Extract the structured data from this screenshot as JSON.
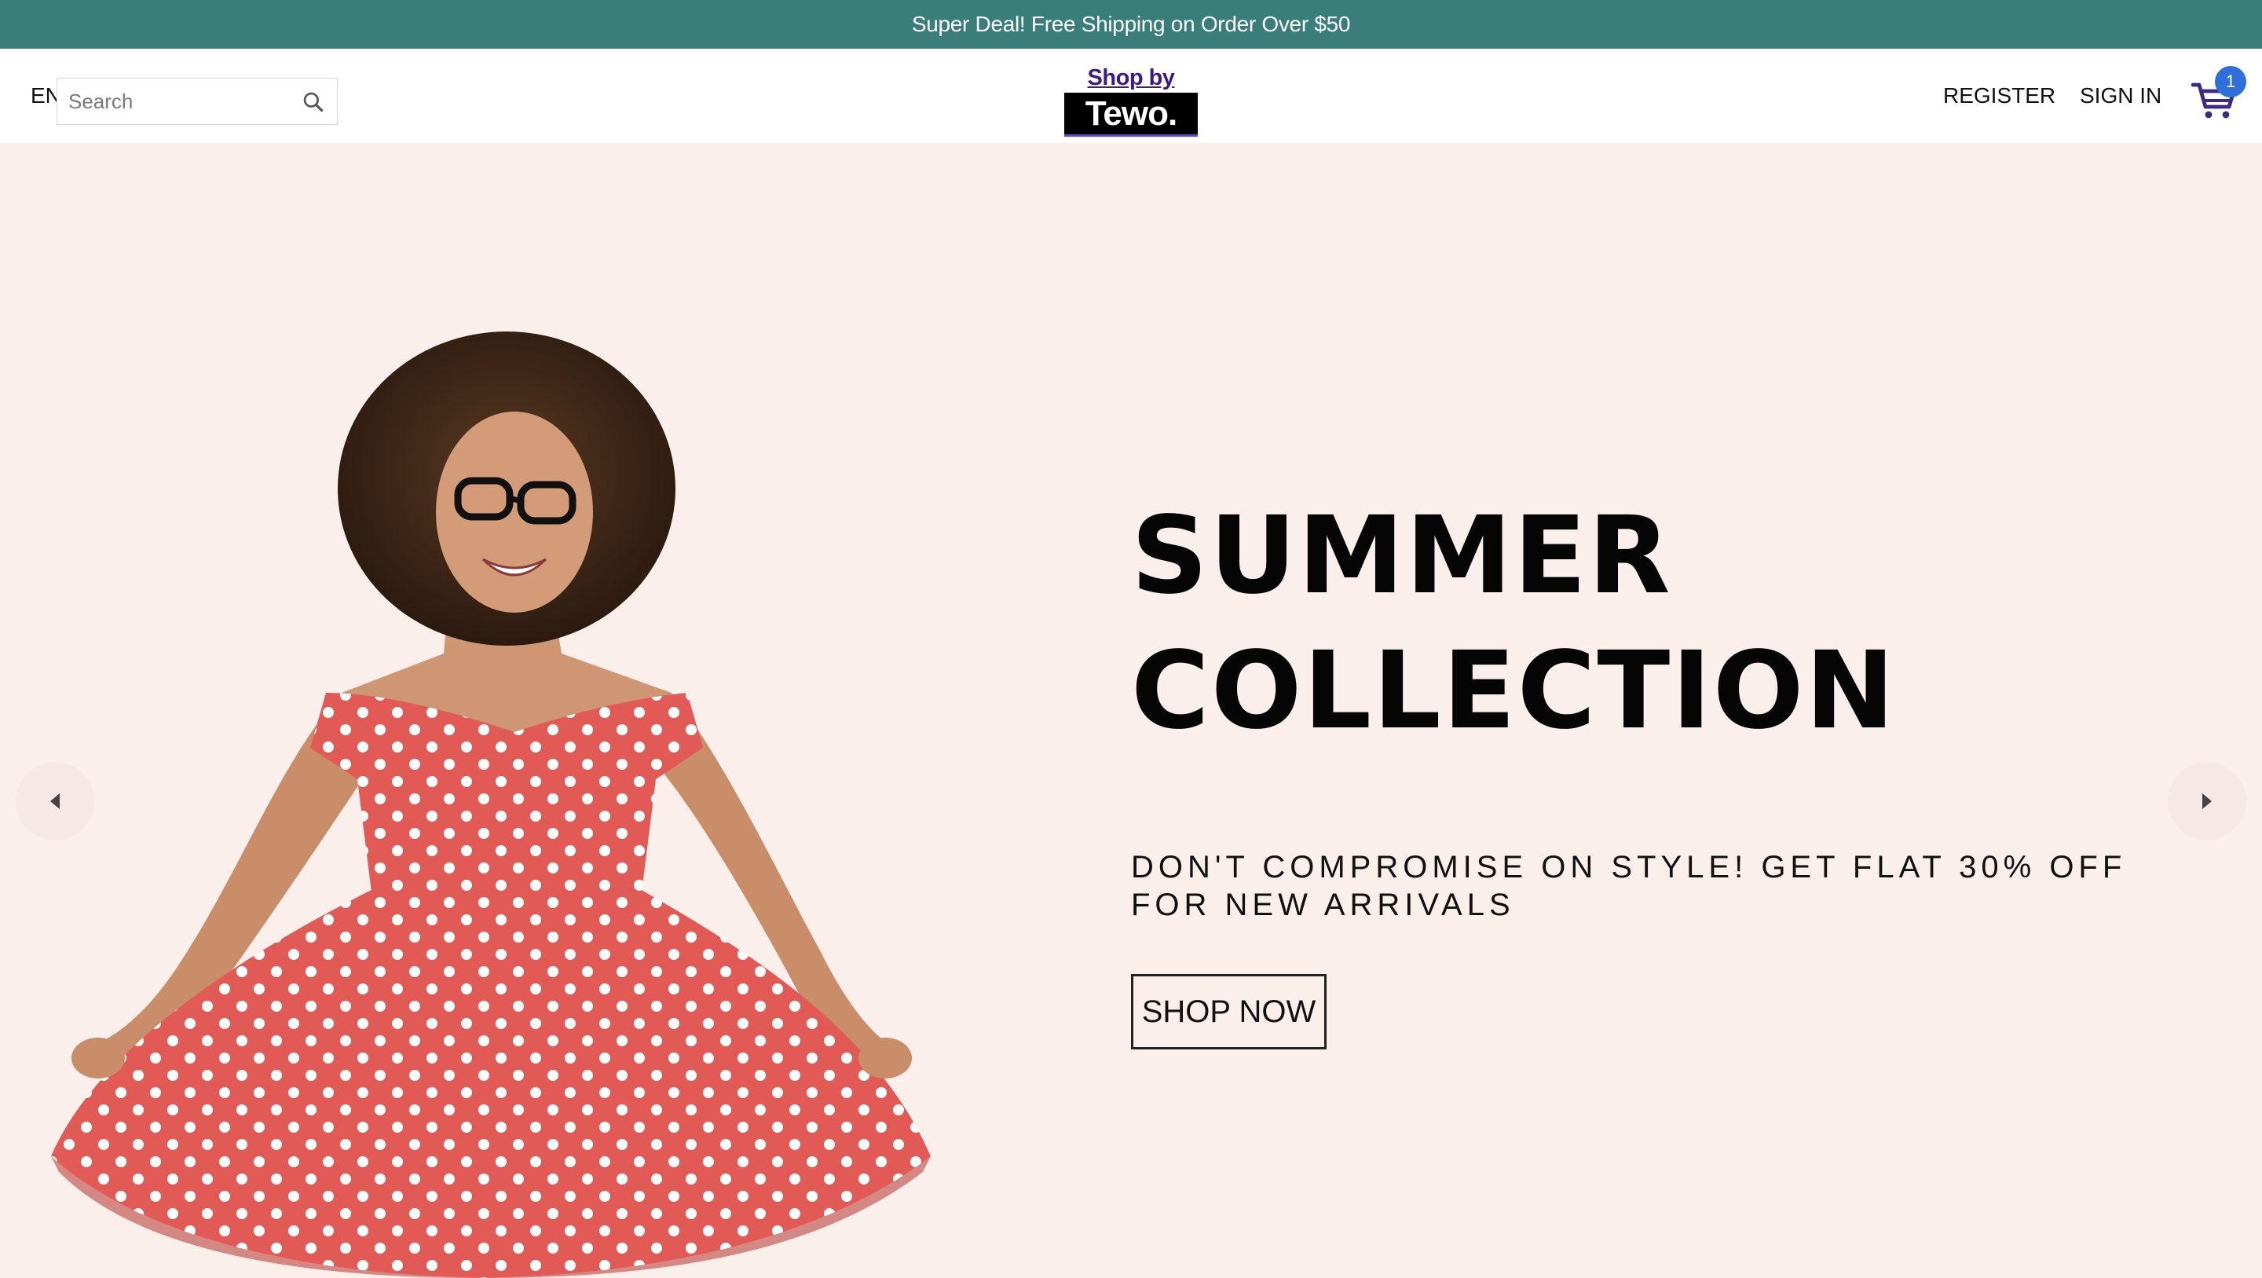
{
  "announcement": {
    "text": "Super Deal! Free Shipping on Order Over $50"
  },
  "header": {
    "language": "EN",
    "search": {
      "placeholder": "Search",
      "value": ""
    },
    "logo": {
      "tagline": "Shop by",
      "brand": "Tewo."
    },
    "nav": {
      "register": "REGISTER",
      "signin": "SIGN IN"
    },
    "cart": {
      "count": "1",
      "icon": "shopping-cart-icon"
    }
  },
  "hero": {
    "title_line1": "SUMMER",
    "title_line2": "COLLECTION",
    "description": "DON'T COMPROMISE ON STYLE! GET FLAT 30% OFF FOR NEW ARRIVALS",
    "button": "SHOP NOW",
    "prev_icon": "arrow-left-icon",
    "next_icon": "arrow-right-icon",
    "image": "woman in red polka dot dress"
  },
  "colors": {
    "announcement_bg": "#3a7e7c",
    "hero_bg": "#fbefec",
    "accent": "#2f6fdc",
    "logo_link": "#3d1a8a",
    "dress": "#e25a56"
  }
}
